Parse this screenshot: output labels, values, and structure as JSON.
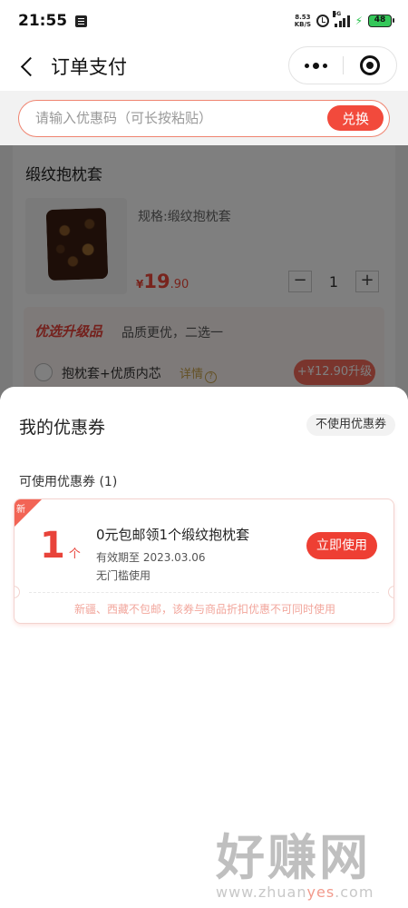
{
  "status_bar": {
    "time": "21:55",
    "net_speed_value": "8.53",
    "net_speed_unit": "KB/S",
    "network_type": "5G",
    "battery": "48"
  },
  "nav": {
    "title": "订单支付"
  },
  "coupon_code": {
    "placeholder": "请输入优惠码（可长按粘贴）",
    "redeem_label": "兑换"
  },
  "product": {
    "title": "缎纹抱枕套",
    "spec": "规格:缎纹抱枕套",
    "price_symbol": "¥",
    "price_int": "19",
    "price_dec": ".90",
    "quantity": "1",
    "minus_label": "−",
    "plus_label": "+"
  },
  "upgrade": {
    "title": "优选升级品",
    "desc": "品质更优，二选一",
    "option_label": "抱枕套+优质内芯",
    "detail_label": "详情",
    "price_label": "+¥12.90升级"
  },
  "sheet": {
    "title": "我的优惠券",
    "no_coupon_label": "不使用优惠券",
    "available_label": "可使用优惠券 (1)"
  },
  "coupon": {
    "badge": "新",
    "amount": "1",
    "unit": "个",
    "name": "0元包邮领1个缎纹抱枕套",
    "expiry": "有效期至 2023.03.06",
    "threshold": "无门槛使用",
    "use_label": "立即使用",
    "note": "新疆、西藏不包邮，该券与商品折扣优惠不可同时使用"
  },
  "watermark": {
    "main": "好赚网",
    "sub_prefix": "www.zhuan",
    "sub_highlight": "yes",
    "sub_suffix": ".com"
  }
}
